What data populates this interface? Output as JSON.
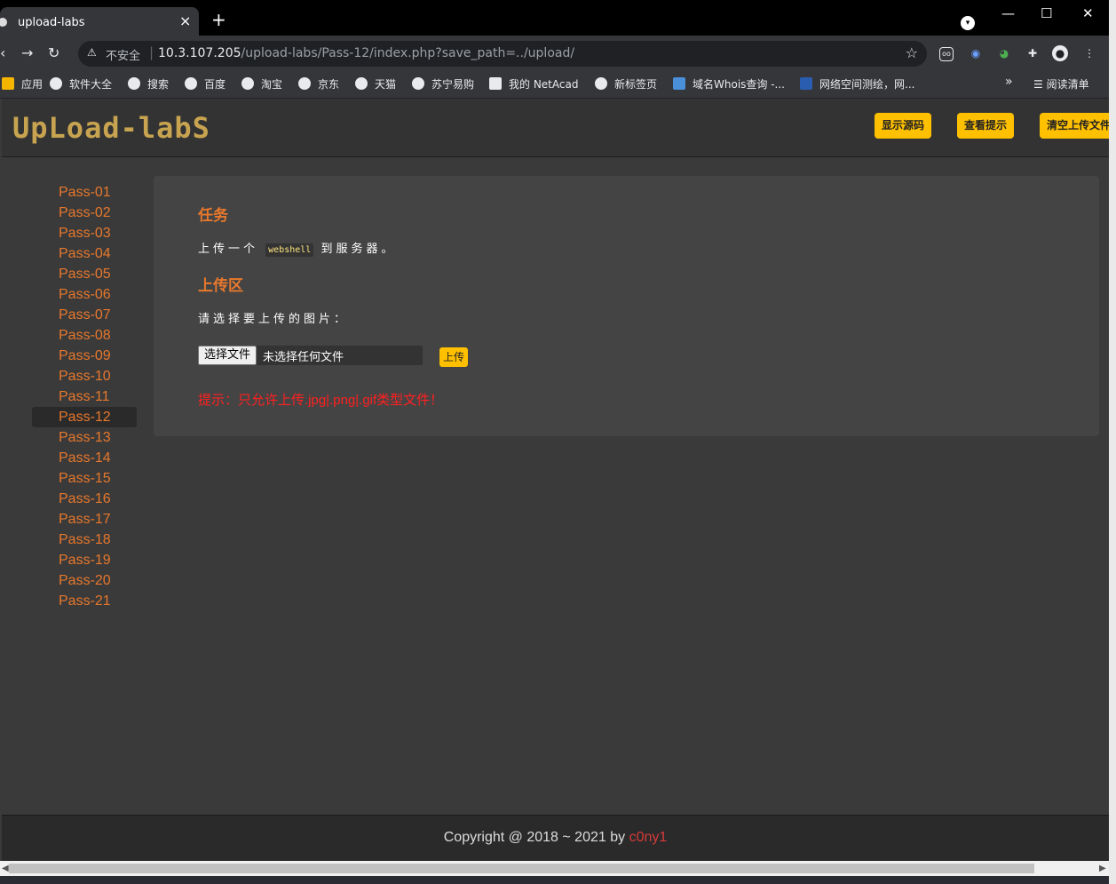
{
  "browser": {
    "tab_title": "upload-labs",
    "tab_close": "×",
    "new_tab": "+",
    "win_min": "—",
    "win_max": "☐",
    "win_close": "✕",
    "insecure_label": "不安全",
    "url_host": "10.3.107.205",
    "url_path": "/upload-labs/Pass-12/index.php?save_path=../upload/",
    "bookmarks": [
      "应用",
      "软件大全",
      "搜索",
      "百度",
      "淘宝",
      "京东",
      "天猫",
      "苏宁易购",
      "我的 NetAcad",
      "新标签页",
      "域名Whois查询 -...",
      "网络空间测绘，网..."
    ],
    "bookmarks_more": "»",
    "reading_list": "阅读清单"
  },
  "header": {
    "logo_text": "UpLoad-labS",
    "buttons": [
      "显示源码",
      "查看提示",
      "清空上传文件"
    ]
  },
  "sidebar": {
    "items": [
      "Pass-01",
      "Pass-02",
      "Pass-03",
      "Pass-04",
      "Pass-05",
      "Pass-06",
      "Pass-07",
      "Pass-08",
      "Pass-09",
      "Pass-10",
      "Pass-11",
      "Pass-12",
      "Pass-13",
      "Pass-14",
      "Pass-15",
      "Pass-16",
      "Pass-17",
      "Pass-18",
      "Pass-19",
      "Pass-20",
      "Pass-21"
    ],
    "active": "Pass-12"
  },
  "main": {
    "task_heading": "任务",
    "task_prefix": "上传一个",
    "task_code": "webshell",
    "task_suffix": "到服务器。",
    "upload_heading": "上传区",
    "choose_label": "请选择要上传的图片：",
    "file_button": "选择文件",
    "file_status": "未选择任何文件",
    "upload_button": "上传",
    "hint": "提示：只允许上传.jpg|.png|.gif类型文件！"
  },
  "footer": {
    "copyright": "Copyright @ 2018 ~ 2021 by ",
    "author": "c0ny1"
  },
  "colors": {
    "accent_orange": "#e8782c",
    "button_yellow": "#ffc000",
    "hint_red": "#ff2020"
  }
}
